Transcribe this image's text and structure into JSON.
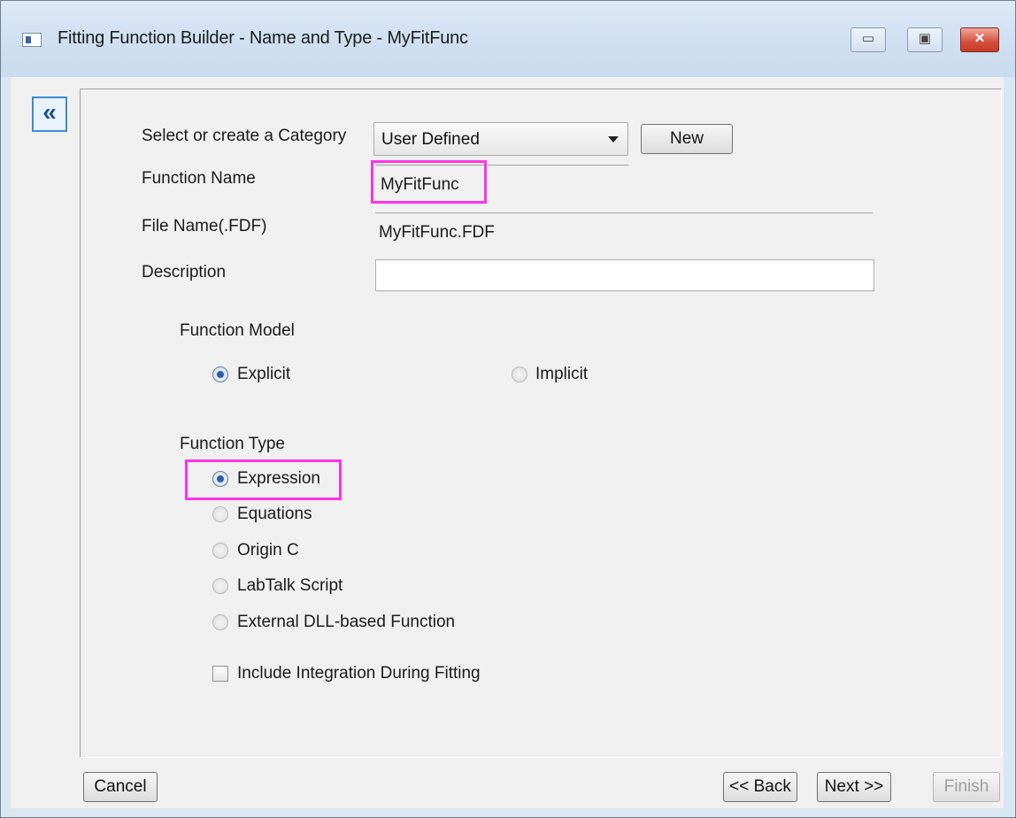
{
  "window": {
    "title": "Fitting Function Builder - Name and Type - MyFitFunc",
    "min_glyph": "▭",
    "max_glyph": "▣",
    "close_glyph": "✕"
  },
  "nav": {
    "collapse_glyph": "«"
  },
  "form": {
    "category_label": "Select or create a Category",
    "category_value": "User Defined",
    "new_button": "New",
    "function_name_label": "Function Name",
    "function_name_value": "MyFitFunc",
    "file_name_label": "File Name(.FDF)",
    "file_name_value": "MyFitFunc.FDF",
    "description_label": "Description",
    "description_value": ""
  },
  "function_model": {
    "label": "Function Model",
    "options": [
      {
        "label": "Explicit",
        "selected": true
      },
      {
        "label": "Implicit",
        "selected": false
      }
    ]
  },
  "function_type": {
    "label": "Function Type",
    "options": [
      {
        "label": "Expression",
        "selected": true
      },
      {
        "label": "Equations",
        "selected": false
      },
      {
        "label": "Origin C",
        "selected": false
      },
      {
        "label": "LabTalk Script",
        "selected": false
      },
      {
        "label": "External DLL-based Function",
        "selected": false
      }
    ]
  },
  "integration": {
    "label": "Include Integration During Fitting",
    "checked": false
  },
  "footer": {
    "cancel": "Cancel",
    "back": "<< Back",
    "next": "Next >>",
    "finish": "Finish"
  },
  "colors": {
    "highlight": "#ff33e6",
    "accent": "#3c8bd6"
  }
}
